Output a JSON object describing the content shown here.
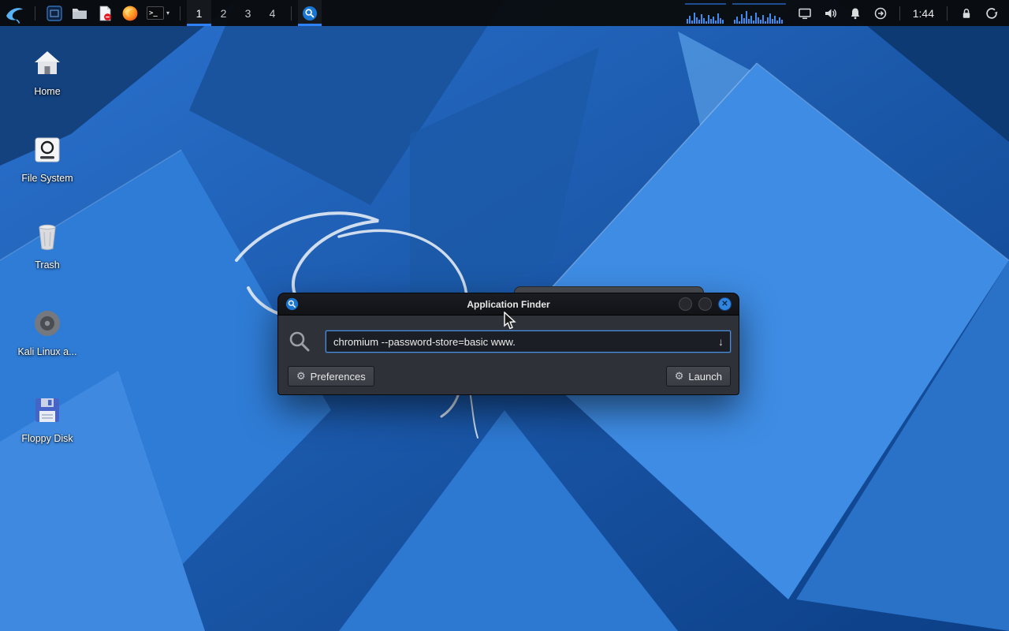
{
  "panel": {
    "workspaces": [
      "1",
      "2",
      "3",
      "4"
    ],
    "clock": "1:44",
    "terminal_prompt": ">_"
  },
  "icons": {
    "gear": "⚙",
    "down_arrow": "↓",
    "close_x": "✕",
    "dropdown_chevron": "▾"
  },
  "desktop": {
    "icons": [
      {
        "label": "Home"
      },
      {
        "label": "File System"
      },
      {
        "label": "Trash"
      },
      {
        "label": "Kali Linux a..."
      },
      {
        "label": "Floppy Disk"
      }
    ]
  },
  "finder": {
    "title": "Application Finder",
    "input_value": "chromium --password-store=basic www.",
    "preferences_label": "Preferences",
    "launch_label": "Launch"
  }
}
